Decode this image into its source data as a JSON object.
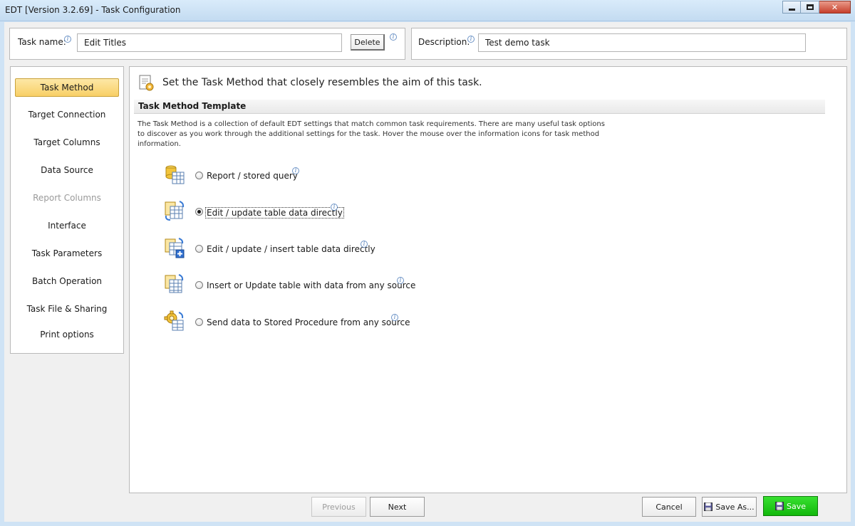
{
  "window": {
    "title": "EDT [Version 3.2.69] - Task Configuration"
  },
  "header": {
    "task_name_label": "Task name:",
    "task_name_value": "Edit Titles",
    "delete_label": "Delete",
    "description_label": "Description:",
    "description_value": "Test demo task"
  },
  "sidebar": {
    "items": [
      {
        "label": "Task Method",
        "state": "active"
      },
      {
        "label": "Target Connection",
        "state": "normal"
      },
      {
        "label": "Target Columns",
        "state": "normal"
      },
      {
        "label": "Data Source",
        "state": "normal"
      },
      {
        "label": "Report Columns",
        "state": "disabled"
      },
      {
        "label": "Interface",
        "state": "normal"
      },
      {
        "label": "Task Parameters",
        "state": "normal"
      },
      {
        "label": "Batch Operation",
        "state": "normal"
      },
      {
        "label": "Task File & Sharing",
        "state": "normal"
      },
      {
        "label": "Print options",
        "state": "normal"
      }
    ]
  },
  "main": {
    "heading": "Set the Task Method that closely resembles the aim of this task.",
    "section_title": "Task Method Template",
    "section_description": "The Task Method is a collection of default EDT settings that match common task requirements. There are many useful task options to discover as you work through the additional settings for the task. Hover the mouse over the information icons for task method information.",
    "options": [
      {
        "label": "Report / stored query",
        "icon": "database-report-icon",
        "selected": false
      },
      {
        "label": "Edit / update table data directly",
        "icon": "table-edit-icon",
        "selected": true
      },
      {
        "label": "Edit / update / insert table data directly",
        "icon": "table-insert-icon",
        "selected": false
      },
      {
        "label": "Insert or Update table with data from any source",
        "icon": "table-import-icon",
        "selected": false
      },
      {
        "label": "Send data to Stored Procedure from any source",
        "icon": "gear-procedure-icon",
        "selected": false
      }
    ]
  },
  "footer": {
    "previous_label": "Previous",
    "next_label": "Next",
    "cancel_label": "Cancel",
    "save_as_label": "Save As...",
    "save_label": "Save"
  },
  "colors": {
    "active_nav": "#f8cf66",
    "save_green": "#1fc019",
    "title_bar": "#c9def2"
  }
}
